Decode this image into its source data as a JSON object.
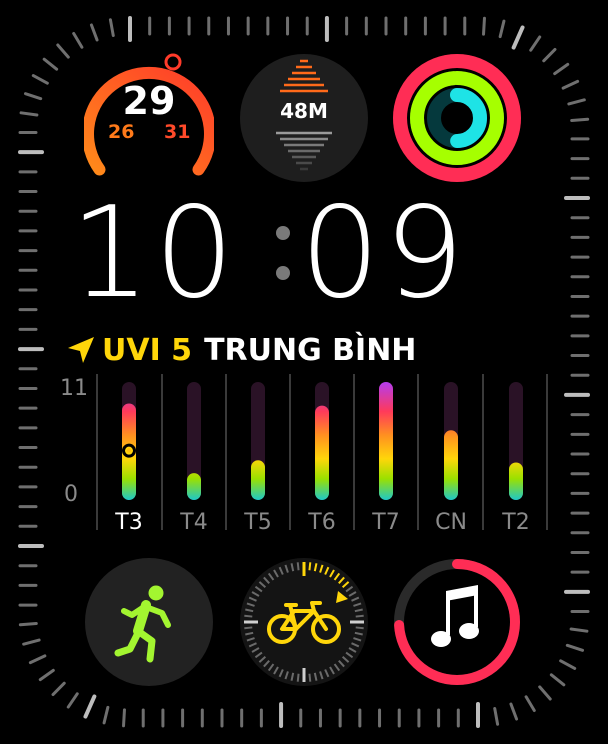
{
  "temperature": {
    "current": "29",
    "low": "26",
    "high": "31"
  },
  "elevation": {
    "value": "48M"
  },
  "time": {
    "hours": "10",
    "minutes": "09"
  },
  "uv": {
    "index_label": "UVI 5",
    "level_label": "TRUNG BÌNH",
    "icon": "location-arrow-icon"
  },
  "uv_chart": {
    "axis_max": "11",
    "axis_min": "0",
    "days": [
      {
        "label": "T3",
        "value": 9,
        "today": true
      },
      {
        "label": "T4",
        "value": 2.5
      },
      {
        "label": "T5",
        "value": 3.7
      },
      {
        "label": "T6",
        "value": 8.8
      },
      {
        "label": "T7",
        "value": 11
      },
      {
        "label": "CN",
        "value": 6.5
      },
      {
        "label": "T2",
        "value": 3.5
      }
    ],
    "current_marker_value": 4.6
  },
  "complications": {
    "activity_icon": "activity-rings-icon",
    "workout_icon": "running-figure-icon",
    "cycling_icon": "bicycle-icon",
    "music_icon": "music-note-icon"
  },
  "colors": {
    "temperature_arc": "#ff6a1a",
    "move_ring": "#ff2d55",
    "exercise_ring": "#a6ff00",
    "stand_ring": "#1ee3e6",
    "uv_accent": "#ffd60a",
    "workout_green": "#a3f530",
    "music_ring": "#ff2d55"
  }
}
